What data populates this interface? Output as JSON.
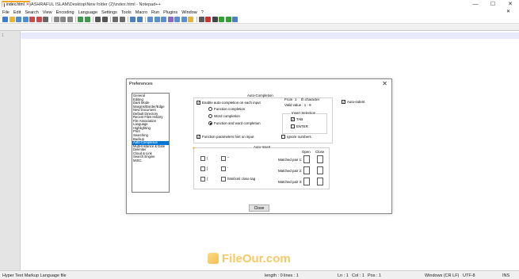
{
  "window": {
    "title": "*C:\\Users\\ASHRAFUL ISLAM\\Desktop\\New folder (2)\\index.html - Notepad++",
    "controls": [
      "—",
      "☐",
      "✕"
    ]
  },
  "menu": {
    "items": [
      "File",
      "Edit",
      "Search",
      "View",
      "Encoding",
      "Language",
      "Settings",
      "Tools",
      "Macro",
      "Run",
      "Plugins",
      "Window",
      "?"
    ],
    "close_glyph": "✕"
  },
  "toolbar": {
    "icons": [
      "new-icon",
      "open-icon",
      "save-icon",
      "save-all-icon",
      "close-icon",
      "close-all-icon",
      "print-icon",
      "cut-icon",
      "copy-icon",
      "paste-icon",
      "undo-icon",
      "redo-icon",
      "find-icon",
      "replace-icon",
      "zoom-in-icon",
      "zoom-out-icon",
      "sync-v-icon",
      "sync-h-icon",
      "wrap-icon",
      "all-chars-icon",
      "indent-guide-icon",
      "udl-icon",
      "doc-map-icon",
      "function-list-icon",
      "folder-workspace-icon",
      "monitor-icon",
      "record-icon",
      "stop-icon",
      "play-icon",
      "run-multi-icon",
      "save-macro-icon"
    ]
  },
  "tab": {
    "label": "index.html",
    "close": "✕"
  },
  "editor": {
    "line_number": "1"
  },
  "statusbar": {
    "filetype": "Hyper Text Markup Language file",
    "length": "length : 0",
    "lines": "lines : 1",
    "ln": "Ln : 1",
    "col": "Col : 1",
    "pos": "Pos : 1",
    "eol": "Windows (CR LF)",
    "encoding": "UTF-8",
    "mode": "INS"
  },
  "watermark": {
    "text": "FileOur.com"
  },
  "dialog": {
    "title": "Preferences",
    "close_glyph": "✕",
    "categories": [
      "General",
      "Editing",
      "Dark Mode",
      "Margins/Border/Edge",
      "New Document",
      "Default Directory",
      "Recent Files History",
      "File Association",
      "Language",
      "Highlighting",
      "Print",
      "Searching",
      "Backup",
      "Auto-Completion",
      "Multi-Instance & Date",
      "Delimiter",
      "Cloud & Link",
      "Search Engine",
      "MISC."
    ],
    "selected_category": "Auto-Completion",
    "autocompletion": {
      "group_title": "Auto-Completion",
      "enable_label": "Enable auto-completion on each input",
      "radio_function": "Function completion",
      "radio_word": "Word completion",
      "radio_function_word": "Function and word completion",
      "from_label": "From",
      "from_value": "1",
      "from_suffix": "th character",
      "valid_value": "Valid value : 1 - 9",
      "insert_selection_title": "Insert Selection",
      "tab_label": "TAB",
      "enter_label": "ENTER",
      "param_hint_label": "Function parameters hint on input",
      "ignore_numbers_label": "Ignore numbers",
      "auto_indent_label": "Auto-indent"
    },
    "autoinsert": {
      "group_title": "Auto-Insert",
      "paren": "(",
      "bracket": "[",
      "brace": "{",
      "dquote": "\"",
      "squote": "'",
      "html_close_tag": "html/xml close tag",
      "open_header": "Open",
      "close_header": "Close",
      "pair1": "Matched pair 1:",
      "pair2": "Matched pair 2:",
      "pair3": "Matched pair 3:"
    },
    "close_button": "Close"
  },
  "colors": {
    "selection": "#0078d7",
    "tab_accent": "#f6a623",
    "current_line": "#e8e8ff",
    "watermark": "#f4c14a"
  }
}
